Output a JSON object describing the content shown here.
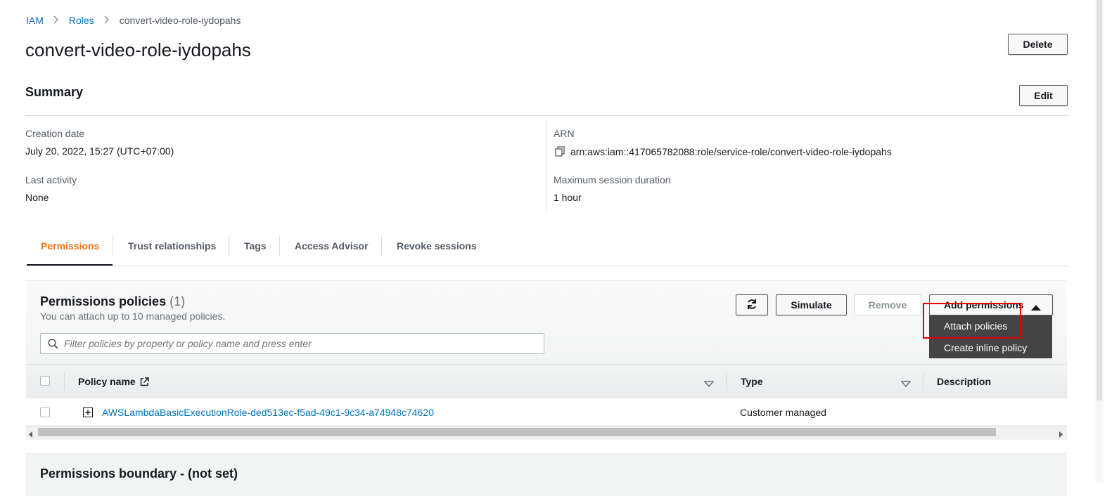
{
  "breadcrumb": {
    "items": [
      "IAM",
      "Roles"
    ],
    "current": "convert-video-role-iydopahs"
  },
  "page": {
    "title": "convert-video-role-iydopahs",
    "delete_label": "Delete"
  },
  "summary": {
    "title": "Summary",
    "edit_label": "Edit",
    "creation_date_label": "Creation date",
    "creation_date_value": "July 20, 2022, 15:27 (UTC+07:00)",
    "last_activity_label": "Last activity",
    "last_activity_value": "None",
    "arn_label": "ARN",
    "arn_value": "arn:aws:iam::417065782088:role/service-role/convert-video-role-iydopahs",
    "max_session_label": "Maximum session duration",
    "max_session_value": "1 hour"
  },
  "tabs": [
    {
      "label": "Permissions",
      "active": true
    },
    {
      "label": "Trust relationships"
    },
    {
      "label": "Tags"
    },
    {
      "label": "Access Advisor"
    },
    {
      "label": "Revoke sessions"
    }
  ],
  "permissions": {
    "title": "Permissions policies",
    "count": "(1)",
    "subtitle": "You can attach up to 10 managed policies.",
    "simulate_label": "Simulate",
    "remove_label": "Remove",
    "add_permissions_label": "Add permissions",
    "filter_placeholder": "Filter policies by property or policy name and press enter",
    "dropdown": [
      "Attach policies",
      "Create inline policy"
    ],
    "columns": [
      "Policy name",
      "Type",
      "Description"
    ],
    "rows": [
      {
        "name": "AWSLambdaBasicExecutionRole-ded513ec-f5ad-49c1-9c34-a74948c74620",
        "type": "Customer managed",
        "description": ""
      }
    ]
  },
  "boundary": {
    "title": "Permissions boundary - (not set)"
  },
  "colors": {
    "link": "#0073bb",
    "active_tab": "#ec7211",
    "highlight": "#e00000",
    "dropdown_bg": "#444444"
  },
  "icons": [
    "chevron-right-icon",
    "copy-icon",
    "refresh-icon",
    "caret-up-icon",
    "external-link-icon",
    "sort-caret-icon",
    "expand-plus-icon",
    "search-icon"
  ]
}
